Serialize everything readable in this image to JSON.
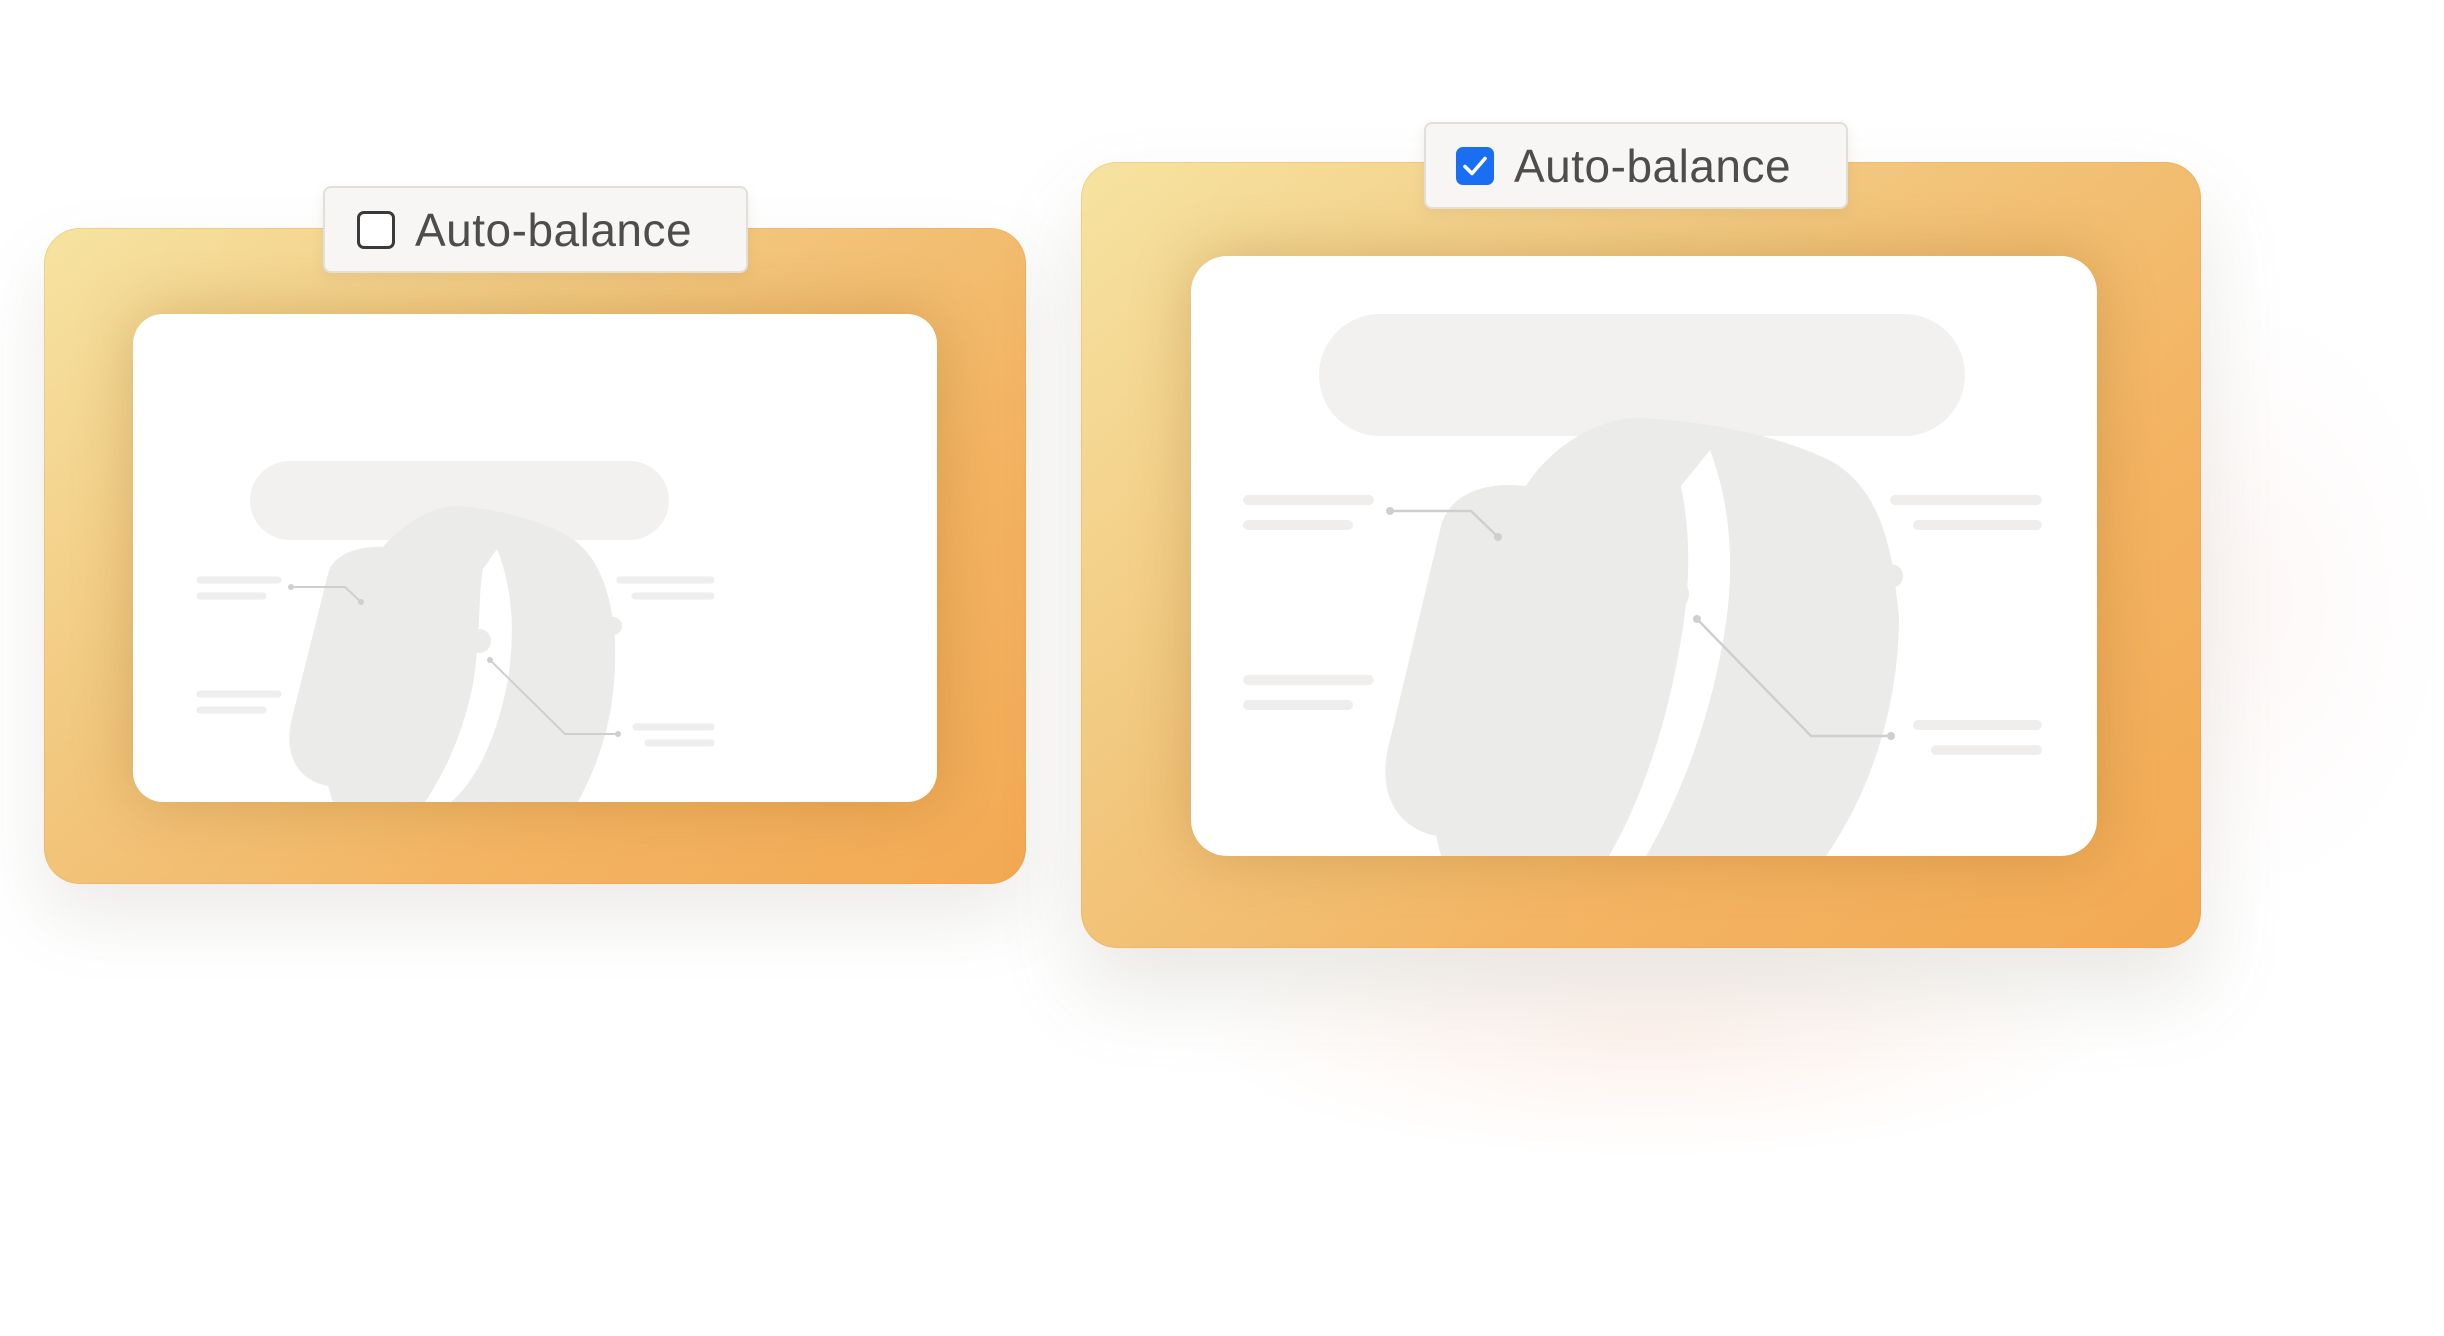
{
  "cards": [
    {
      "id": "unbalanced",
      "checkbox": {
        "label": "Auto-balance",
        "checked": false
      }
    },
    {
      "id": "balanced",
      "checkbox": {
        "label": "Auto-balance",
        "checked": true,
        "check_color": "#1a6ef2"
      }
    }
  ],
  "colors": {
    "panel_gradient": [
      "#f6e3a1",
      "#f2c77e",
      "#f3b463",
      "#f3a953"
    ],
    "placeholder_fill": "#ebebea",
    "title_bar_fill": "#f2f1f0",
    "callout_line": "#cfcfcf"
  },
  "icons": {
    "illustration": "watch-illustration-icon",
    "checkmark": "checkmark-icon"
  }
}
